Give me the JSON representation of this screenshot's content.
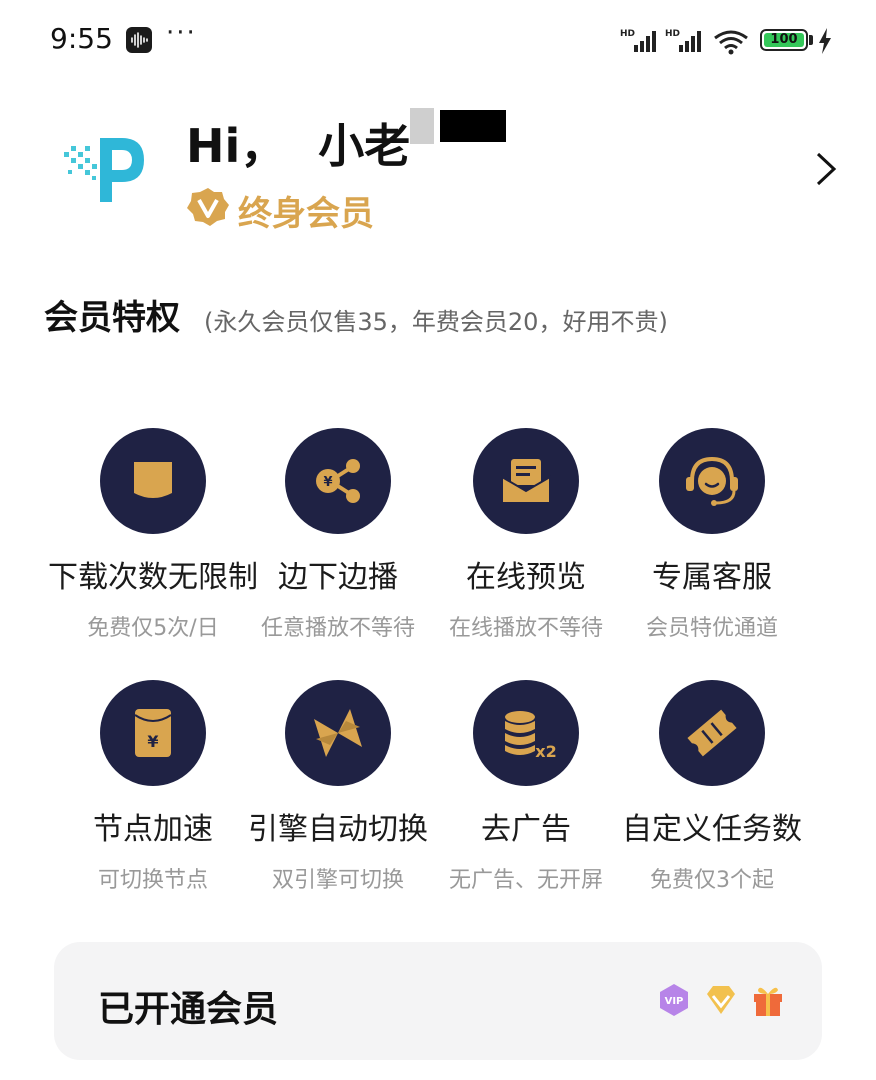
{
  "status_bar": {
    "time": "9:55",
    "more": "···",
    "signal_label": "HD",
    "battery": "100"
  },
  "profile": {
    "greeting": "Hi，  小老",
    "member_type": "终身会员"
  },
  "privileges": {
    "title": "会员特权",
    "note": "(永久会员仅售35，年费会员20，好用不贵)",
    "items": [
      {
        "title": "下载次数无限制",
        "desc": "免费仅5次/日",
        "icon": "pocket-icon"
      },
      {
        "title": "边下边播",
        "desc": "任意播放不等待",
        "icon": "share-yen-icon"
      },
      {
        "title": "在线预览",
        "desc": "在线播放不等待",
        "icon": "mail-open-icon"
      },
      {
        "title": "专属客服",
        "desc": "会员特优通道",
        "icon": "headset-icon"
      },
      {
        "title": "节点加速",
        "desc": "可切换节点",
        "icon": "red-envelope-icon"
      },
      {
        "title": "引擎自动切换",
        "desc": "双引擎可切换",
        "icon": "switch-icon"
      },
      {
        "title": "去广告",
        "desc": "无广告、无开屏",
        "icon": "coin-stack-icon"
      },
      {
        "title": "自定义任务数",
        "desc": "免费仅3个起",
        "icon": "ticket-icon"
      }
    ]
  },
  "member_card": {
    "title": "已开通会员",
    "icons": [
      "vip-icon",
      "diamond-icon",
      "gift-icon"
    ]
  },
  "colors": {
    "circle_bg": "#1f2244",
    "icon_gold": "#d9a54f",
    "card_bg": "#f4f4f5"
  }
}
